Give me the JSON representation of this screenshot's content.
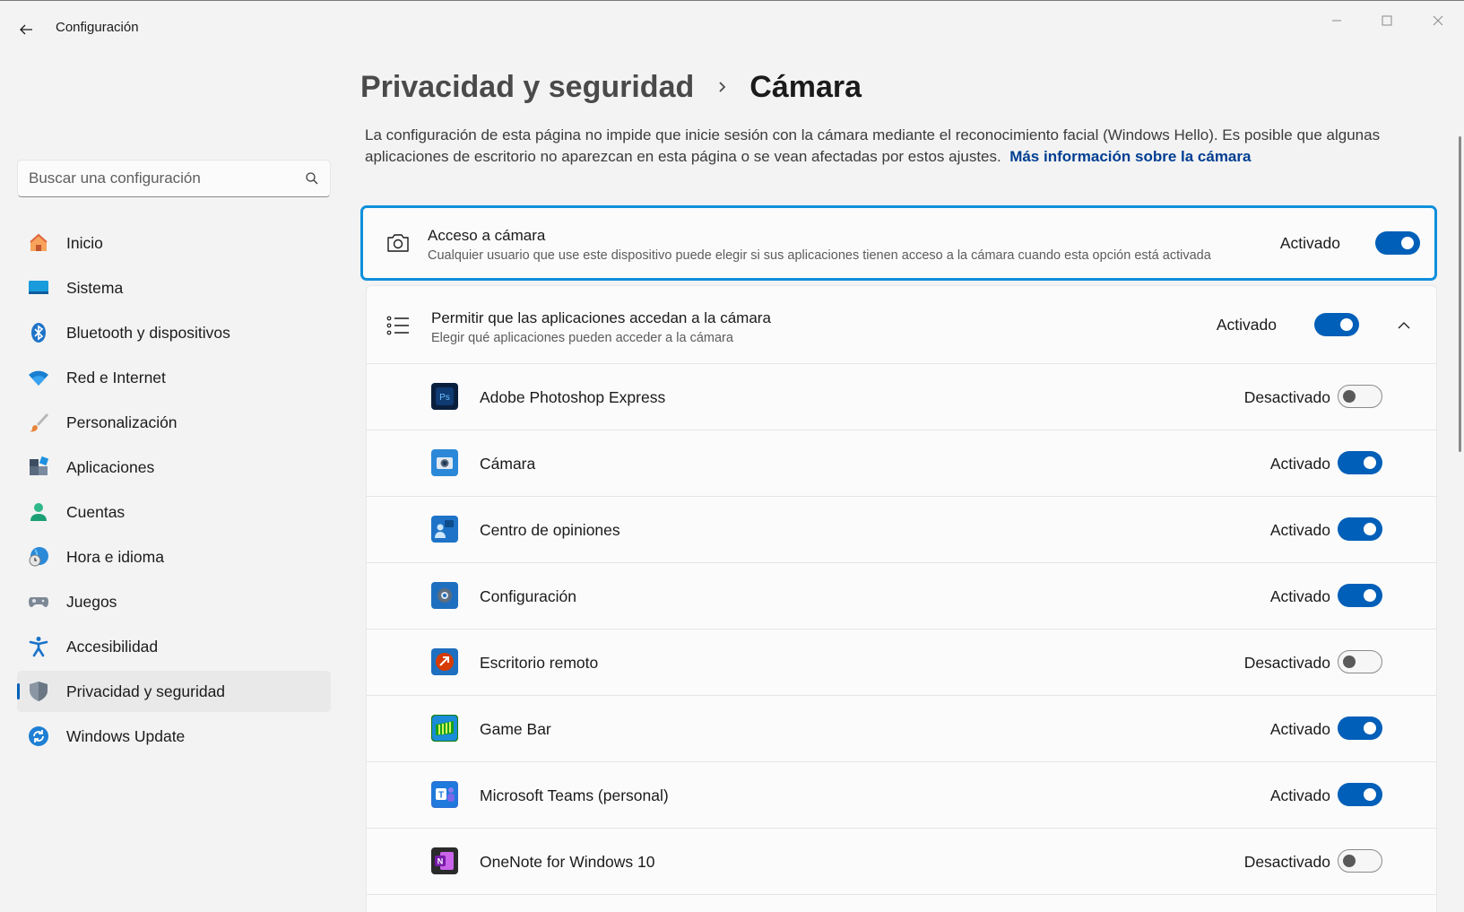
{
  "window": {
    "title": "Configuración",
    "back_icon": "back-arrow-icon",
    "controls": [
      "minimize-icon",
      "maximize-icon",
      "close-icon"
    ]
  },
  "sidebar": {
    "search": {
      "placeholder": "Buscar una configuración",
      "value": ""
    },
    "items": [
      {
        "label": "Inicio",
        "icon": "home-icon"
      },
      {
        "label": "Sistema",
        "icon": "system-icon"
      },
      {
        "label": "Bluetooth y dispositivos",
        "icon": "bluetooth-icon"
      },
      {
        "label": "Red e Internet",
        "icon": "wifi-icon"
      },
      {
        "label": "Personalización",
        "icon": "brush-icon"
      },
      {
        "label": "Aplicaciones",
        "icon": "apps-icon"
      },
      {
        "label": "Cuentas",
        "icon": "account-icon"
      },
      {
        "label": "Hora e idioma",
        "icon": "time-language-icon"
      },
      {
        "label": "Juegos",
        "icon": "gamepad-icon"
      },
      {
        "label": "Accesibilidad",
        "icon": "accessibility-icon"
      },
      {
        "label": "Privacidad y seguridad",
        "icon": "shield-icon",
        "active": true
      },
      {
        "label": "Windows Update",
        "icon": "update-icon"
      }
    ]
  },
  "main": {
    "breadcrumb": {
      "parent": "Privacidad y seguridad",
      "current": "Cámara"
    },
    "description": {
      "text": "La configuración de esta página no impide que inicie sesión con la cámara mediante el reconocimiento facial (Windows Hello). Es posible que algunas aplicaciones de escritorio no aparezcan en esta página o se vean afectadas por estos ajustes.",
      "link": "Más información sobre la cámara"
    },
    "camera_access": {
      "title": "Acceso a cámara",
      "subtitle": "Cualquier usuario que use este dispositivo puede elegir si sus aplicaciones tienen acceso a la cámara cuando esta opción está activada",
      "state": "Activado",
      "on": true
    },
    "app_access": {
      "title": "Permitir que las aplicaciones accedan a la cámara",
      "subtitle": "Elegir qué aplicaciones pueden acceder a la cámara",
      "state": "Activado",
      "on": true,
      "expanded": true
    },
    "apps": [
      {
        "name": "Adobe Photoshop Express",
        "state": "Desactivado",
        "on": false,
        "icon": "photoshop-express-icon",
        "color": "#0a1f3e"
      },
      {
        "name": "Cámara",
        "state": "Activado",
        "on": true,
        "icon": "camera-app-icon",
        "color": "#2b88d8"
      },
      {
        "name": "Centro de opiniones",
        "state": "Activado",
        "on": true,
        "icon": "feedback-hub-icon",
        "color": "#1e73c8"
      },
      {
        "name": "Configuración",
        "state": "Activado",
        "on": true,
        "icon": "settings-app-icon",
        "color": "#1e6fbf"
      },
      {
        "name": "Escritorio remoto",
        "state": "Desactivado",
        "on": false,
        "icon": "remote-desktop-icon",
        "color": "#d83b01"
      },
      {
        "name": "Game Bar",
        "state": "Activado",
        "on": true,
        "icon": "game-bar-icon",
        "color": "#107c10"
      },
      {
        "name": "Microsoft Teams (personal)",
        "state": "Activado",
        "on": true,
        "icon": "teams-icon",
        "color": "#2f6fd4"
      },
      {
        "name": "OneNote for Windows 10",
        "state": "Desactivado",
        "on": false,
        "icon": "onenote-icon",
        "color": "#7719aa"
      }
    ]
  },
  "colors": {
    "accent": "#005fb8",
    "focus": "#0f8fdc",
    "link": "#003e92"
  }
}
